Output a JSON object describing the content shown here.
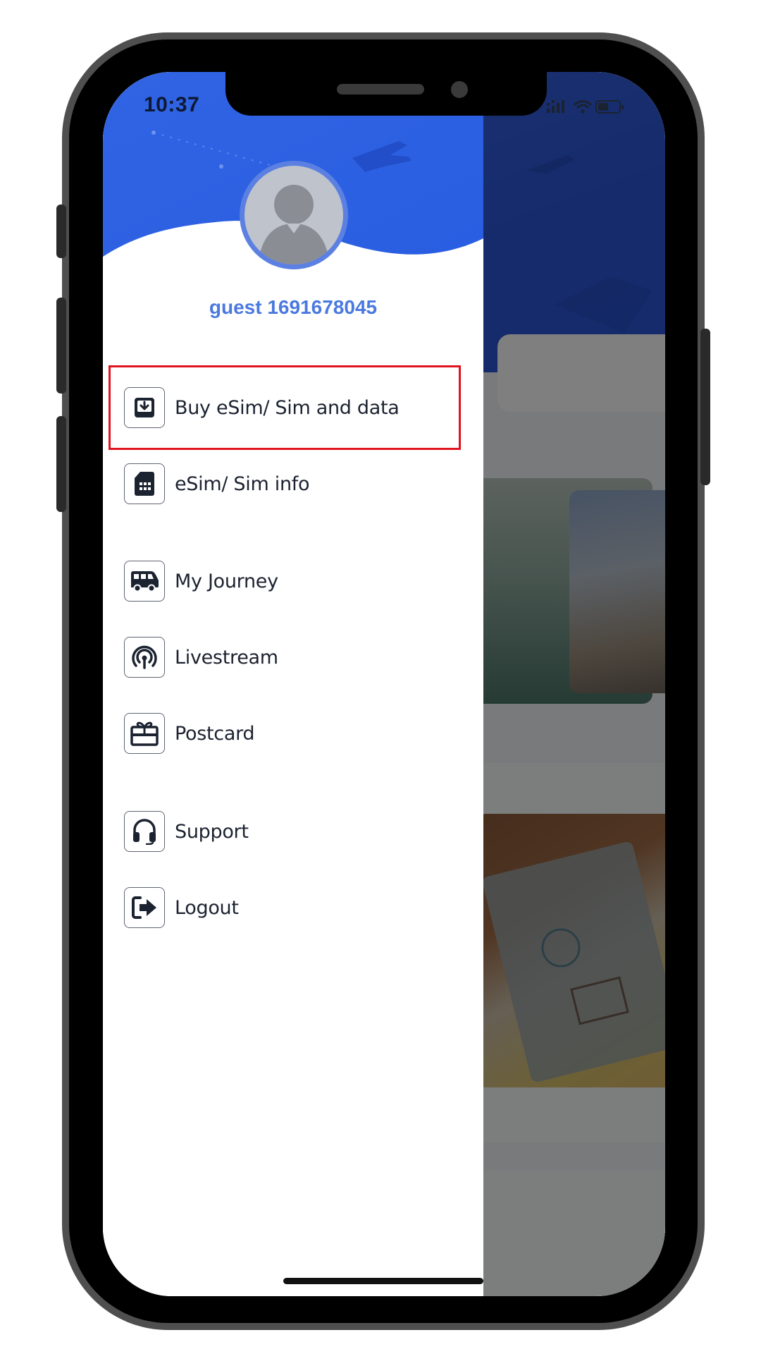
{
  "status_bar": {
    "time": "10:37",
    "icons": [
      "signal-icon",
      "wifi-icon",
      "battery-icon"
    ]
  },
  "drawer": {
    "username": "guest 1691678045",
    "avatar_icon": "user-avatar-icon",
    "highlighted_item": "buy-esim",
    "menu": [
      {
        "id": "buy-esim",
        "label": "Buy eSim/ Sim and data",
        "icon": "download-box-icon"
      },
      {
        "id": "esim-info",
        "label": "eSim/ Sim info",
        "icon": "sim-card-icon"
      },
      {
        "id": "my-journey",
        "label": "My Journey",
        "icon": "van-icon"
      },
      {
        "id": "livestream",
        "label": "Livestream",
        "icon": "broadcast-icon"
      },
      {
        "id": "postcard",
        "label": "Postcard",
        "icon": "gift-card-icon"
      },
      {
        "id": "support",
        "label": "Support",
        "icon": "headphones-icon"
      },
      {
        "id": "logout",
        "label": "Logout",
        "icon": "logout-icon"
      }
    ]
  },
  "colors": {
    "brand_blue": "#2f62e6",
    "username_blue": "#4a79df",
    "highlight_red": "#e0141e",
    "menu_text": "#1b2230"
  }
}
